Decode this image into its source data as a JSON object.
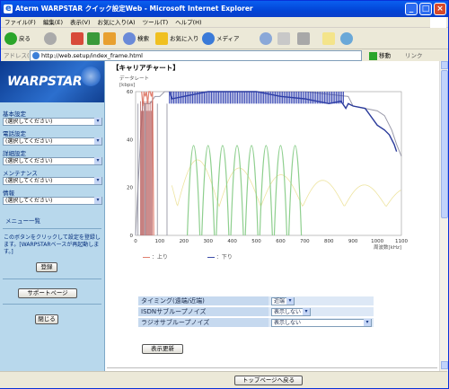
{
  "window": {
    "title": "Aterm WARPSTAR クイック設定Web - Microsoft Internet Explorer"
  },
  "menu": [
    "ファイル(F)",
    "編集(E)",
    "表示(V)",
    "お気に入り(A)",
    "ツール(T)",
    "ヘルプ(H)"
  ],
  "toolbar": {
    "back": "戻る",
    "search": "検索",
    "favorites": "お気に入り",
    "media": "メディア"
  },
  "address": {
    "label": "アドレス(D)",
    "url": "http://web.setup/index_frame.html",
    "go": "移動",
    "links": "リンク"
  },
  "sidebar": {
    "logo": "WARPSTAR",
    "groups": [
      {
        "title": "基本設定",
        "select": "(選択してください)"
      },
      {
        "title": "電話設定",
        "select": "(選択してください)"
      },
      {
        "title": "詳細設定",
        "select": "(選択してください)"
      },
      {
        "title": "メンテナンス",
        "select": "(選択してください)"
      },
      {
        "title": "情報",
        "select": "(選択してください)"
      }
    ],
    "menu_list": "メニュー一覧",
    "notice": "このボタンをクリックして設定を登録します。[WARPSTARベースが再起動します。]",
    "register": "登録",
    "support": "サポートページ",
    "close": "閉じる"
  },
  "main": {
    "title": "【キャリアチャート】",
    "update": "表示更新",
    "to_top": "トップページへ戻る"
  },
  "settings": [
    {
      "label": "タイミング(遠端/近端)",
      "value": "近端"
    },
    {
      "label": "ISDNサブループノイズ",
      "value": "表示しない"
    },
    {
      "label": "ラジオサブループノイズ",
      "value": "表示しない"
    }
  ],
  "chart_data": {
    "type": "line",
    "title": "",
    "ylabel": "データレート\n[kbps]",
    "xlabel": "周波数[kHz]",
    "xlim": [
      0,
      1100
    ],
    "ylim": [
      0,
      60
    ],
    "xticks": [
      0,
      100,
      200,
      300,
      400,
      500,
      600,
      700,
      800,
      900,
      1000,
      1100
    ],
    "yticks": [
      0,
      20,
      40,
      60
    ],
    "colors": {
      "up": "#e08070",
      "down": "#2a3a9a",
      "profile": "#9a9aaa",
      "green_noise": "#8ecf8e",
      "yellow_noise": "#eee4a0"
    },
    "legend": [
      {
        "label": "：上り",
        "color": "#e08070"
      },
      {
        "label": "：下り",
        "color": "#3c4ca8"
      }
    ],
    "series": [
      {
        "name": "上り",
        "x": [
          25,
          30,
          35,
          40,
          45,
          50,
          55,
          60,
          65,
          70,
          75
        ],
        "y": [
          60,
          54,
          60,
          58,
          60,
          55,
          60,
          60,
          58,
          60,
          0
        ]
      },
      {
        "name": "下り",
        "x": [
          140,
          150,
          200,
          300,
          400,
          500,
          600,
          700,
          800,
          850,
          870,
          880,
          900,
          950,
          1000,
          1030,
          1050,
          1070,
          1080
        ],
        "y": [
          60,
          57,
          58,
          60,
          60,
          60,
          58,
          57,
          55,
          56,
          53,
          55,
          54,
          53,
          46,
          44,
          42,
          38,
          35
        ]
      },
      {
        "name": "profile",
        "x": [
          0,
          10,
          20,
          30,
          60,
          80,
          100,
          120,
          140,
          700,
          880,
          900,
          1000,
          1030,
          1060,
          1080,
          1100
        ],
        "y": [
          0,
          20,
          40,
          55,
          55,
          58,
          58,
          60,
          60,
          60,
          58,
          54,
          52,
          50,
          44,
          38,
          33
        ]
      }
    ]
  }
}
